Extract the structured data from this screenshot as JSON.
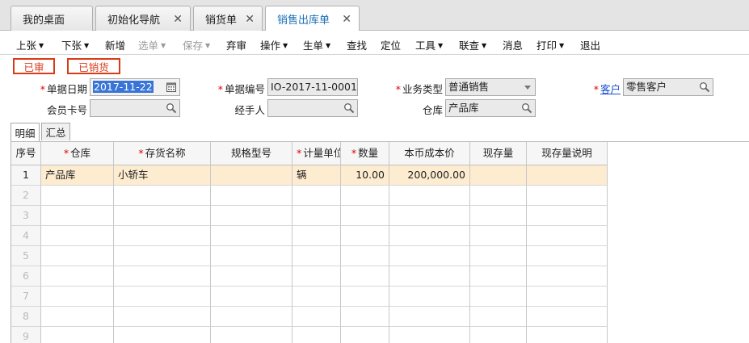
{
  "tabs": [
    {
      "label": "我的桌面",
      "closable": false
    },
    {
      "label": "初始化导航",
      "closable": true
    },
    {
      "label": "销货单",
      "closable": true
    },
    {
      "label": "销售出库单",
      "closable": true,
      "active": true
    }
  ],
  "toolbar": [
    {
      "label": "上张",
      "caret": true
    },
    {
      "label": "下张",
      "caret": true
    },
    {
      "label": "新增"
    },
    {
      "label": "选单",
      "caret": true,
      "disabled": true
    },
    {
      "label": "保存",
      "caret": true,
      "disabled": true
    },
    {
      "label": "弃审"
    },
    {
      "label": "操作",
      "caret": true
    },
    {
      "label": "生单",
      "caret": true
    },
    {
      "label": "查找"
    },
    {
      "label": "定位"
    },
    {
      "label": "工具",
      "caret": true
    },
    {
      "label": "联查",
      "caret": true
    },
    {
      "label": "消息"
    },
    {
      "label": "打印",
      "caret": true
    },
    {
      "label": "退出"
    }
  ],
  "stamps": [
    "已审",
    "已销货"
  ],
  "form": {
    "date_label": "单据日期",
    "date_value": "2017-11-22",
    "code_label": "单据编号",
    "code_value": "IO-2017-11-0001",
    "biz_label": "业务类型",
    "biz_value": "普通销售",
    "customer_label": "客户",
    "customer_value": "零售客户",
    "member_label": "会员卡号",
    "member_value": "",
    "handler_label": "经手人",
    "handler_value": "",
    "warehouse_label": "仓库",
    "warehouse_value": "产品库"
  },
  "subtabs": [
    "明细",
    "汇总"
  ],
  "grid": {
    "columns": [
      {
        "label": "序号",
        "required": false
      },
      {
        "label": "仓库",
        "required": true
      },
      {
        "label": "存货名称",
        "required": true
      },
      {
        "label": "规格型号",
        "required": false
      },
      {
        "label": "计量单位",
        "required": true
      },
      {
        "label": "数量",
        "required": true
      },
      {
        "label": "本币成本价",
        "required": false
      },
      {
        "label": "现存量",
        "required": false
      },
      {
        "label": "现存量说明",
        "required": false
      }
    ],
    "rows": [
      {
        "no": "1",
        "warehouse": "产品库",
        "name": "小轿车",
        "spec": "",
        "unit": "辆",
        "qty": "10.00",
        "cost": "200,000.00",
        "stock": "",
        "stock_note": ""
      },
      {
        "no": "2"
      },
      {
        "no": "3"
      },
      {
        "no": "4"
      },
      {
        "no": "5"
      },
      {
        "no": "6"
      },
      {
        "no": "7"
      },
      {
        "no": "8"
      },
      {
        "no": "9"
      }
    ]
  }
}
